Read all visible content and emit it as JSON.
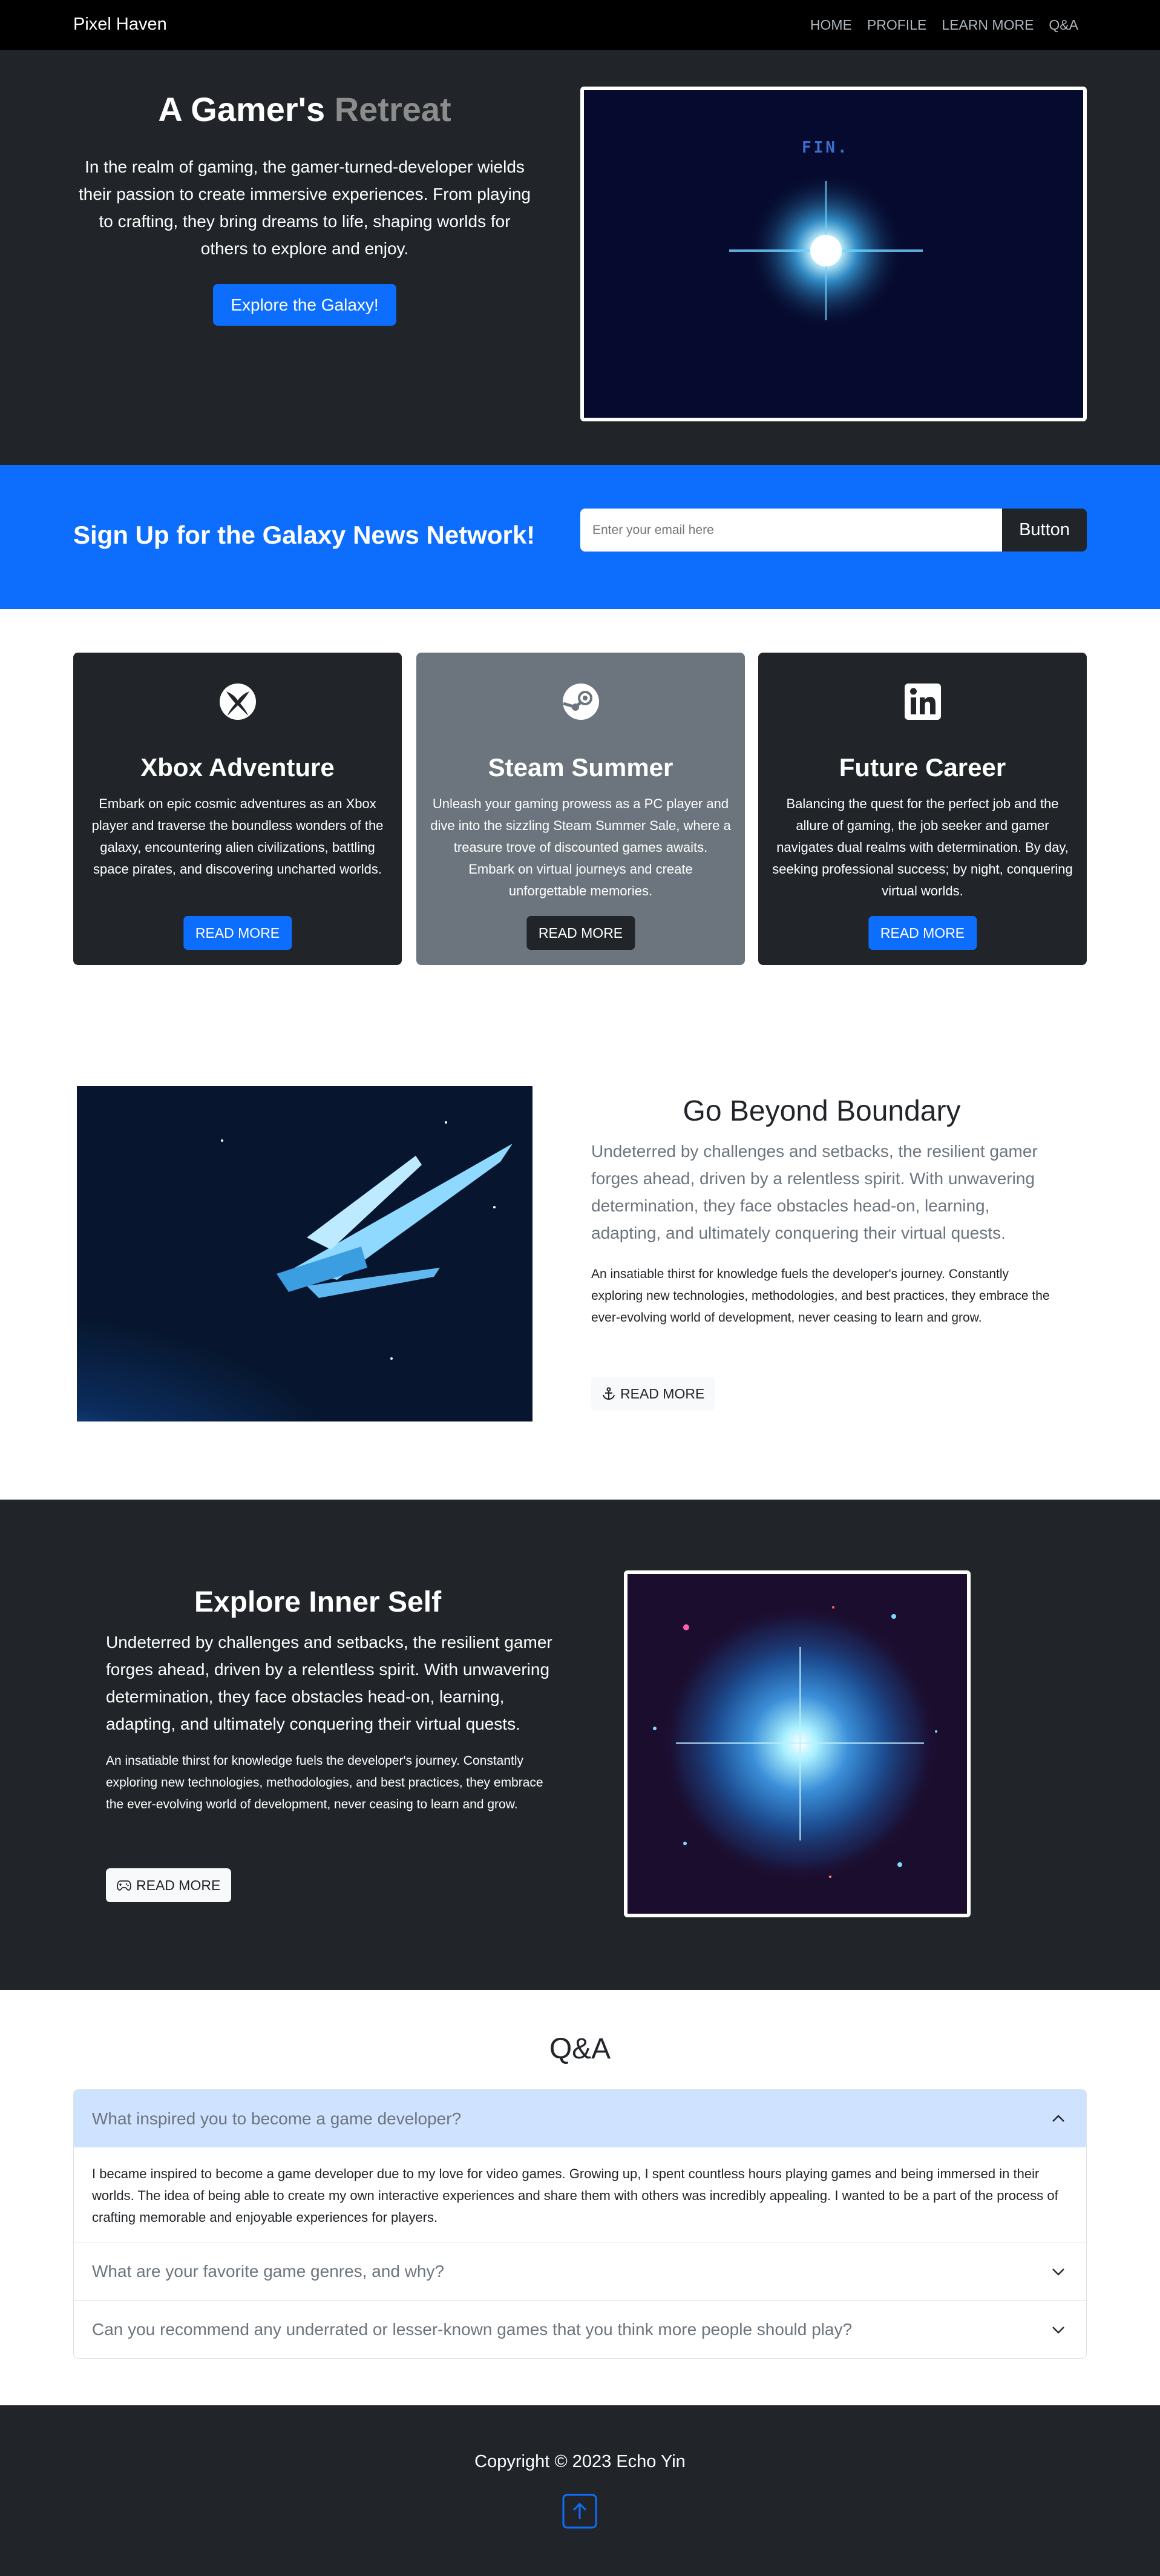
{
  "navbar": {
    "brand": "Pixel Haven",
    "links": [
      "HOME",
      "PROFILE",
      "LEARN MORE",
      "Q&A"
    ]
  },
  "hero": {
    "title_main": "A Gamer's ",
    "title_muted": "Retreat",
    "lead": "In the realm of gaming, the gamer-turned-developer wields their passion to create immersive experiences. From playing to crafting, they bring dreams to life, shaping worlds for others to explore and enjoy.",
    "button": "Explore the Galaxy!",
    "image_caption": "FIN."
  },
  "signup": {
    "heading": "Sign Up for the Galaxy News Network!",
    "placeholder": "Enter your email here",
    "button": "Button"
  },
  "cards": [
    {
      "icon": "xbox-icon",
      "title": "Xbox Adventure",
      "text": "Embark on epic cosmic adventures as an Xbox player and traverse the boundless wonders of the galaxy, encountering alien civilizations, battling space pirates, and discovering uncharted worlds.",
      "button": "READ MORE"
    },
    {
      "icon": "steam-icon",
      "title": "Steam Summer",
      "text": "Unleash your gaming prowess as a PC player and dive into the sizzling Steam Summer Sale, where a treasure trove of discounted games awaits. Embark on virtual journeys and create unforgettable memories.",
      "button": "READ MORE"
    },
    {
      "icon": "linkedin-icon",
      "title": "Future Career",
      "text": "Balancing the quest for the perfect job and the allure of gaming, the job seeker and gamer navigates dual realms with determination. By day, seeking professional success; by night, conquering virtual worlds.",
      "button": "READ MORE"
    }
  ],
  "boundary": {
    "title": "Go Beyond Boundary",
    "lead": "Undeterred by challenges and setbacks, the resilient gamer forges ahead, driven by a relentless spirit. With unwavering determination, they face obstacles head-on, learning, adapting, and ultimately conquering their virtual quests.",
    "text": "An insatiable thirst for knowledge fuels the developer's journey. Constantly exploring new technologies, methodologies, and best practices, they embrace the ever-evolving world of development, never ceasing to learn and grow.",
    "button": "READ MORE"
  },
  "explore": {
    "title": "Explore Inner Self",
    "lead": "Undeterred by challenges and setbacks, the resilient gamer forges ahead, driven by a relentless spirit. With unwavering determination, they face obstacles head-on, learning, adapting, and ultimately conquering their virtual quests.",
    "text": "An insatiable thirst for knowledge fuels the developer's journey. Constantly exploring new technologies, methodologies, and best practices, they embrace the ever-evolving world of development, never ceasing to learn and grow.",
    "button": "READ MORE"
  },
  "qa": {
    "title": "Q&A",
    "items": [
      {
        "question": "What inspired you to become a game developer?",
        "answer": "I became inspired to become a game developer due to my love for video games. Growing up, I spent countless hours playing games and being immersed in their worlds. The idea of being able to create my own interactive experiences and share them with others was incredibly appealing. I wanted to be a part of the process of crafting memorable and enjoyable experiences for players."
      },
      {
        "question": "What are your favorite game genres, and why?"
      },
      {
        "question": "Can you recommend any underrated or lesser-known games that you think more people should play?"
      }
    ]
  },
  "footer": {
    "copyright": "Copyright © 2023 Echo Yin"
  },
  "colors": {
    "primary": "#0d6efd",
    "dark": "#212529",
    "secondary": "#6c757d",
    "accordion_open": "#cfe2ff"
  }
}
